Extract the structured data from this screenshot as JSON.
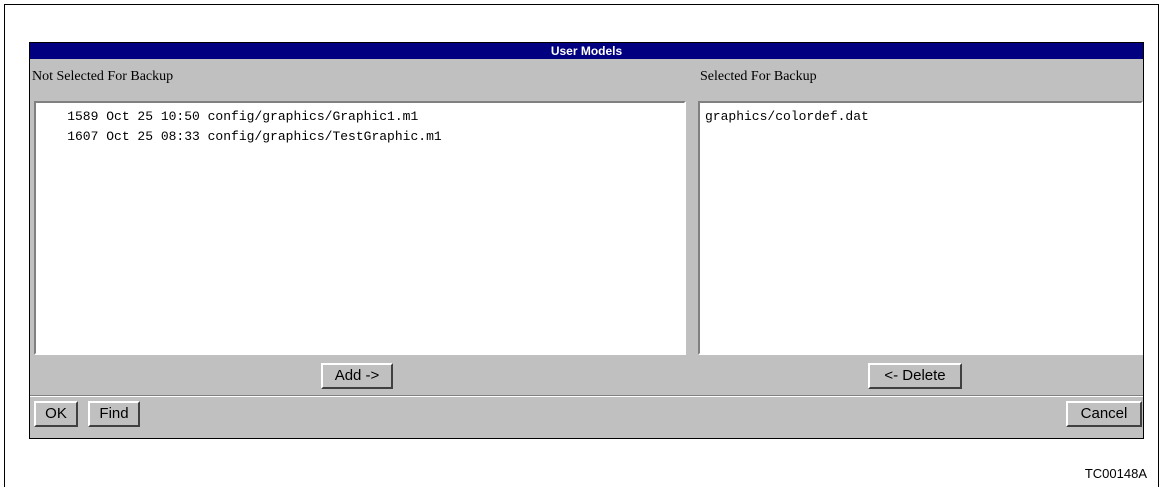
{
  "dialog": {
    "title": "User Models"
  },
  "left_pane": {
    "label": "Not Selected For Backup",
    "items": [
      "    1589 Oct 25 10:50 config/graphics/Graphic1.m1",
      "    1607 Oct 25 08:33 config/graphics/TestGraphic.m1"
    ],
    "add_button": "Add ->"
  },
  "right_pane": {
    "label": "Selected For Backup",
    "items": [
      "graphics/colordef.dat"
    ],
    "delete_button": "<- Delete"
  },
  "footer": {
    "ok_button": "OK",
    "find_button": "Find",
    "cancel_button": "Cancel"
  },
  "figure_id": "TC00148A"
}
